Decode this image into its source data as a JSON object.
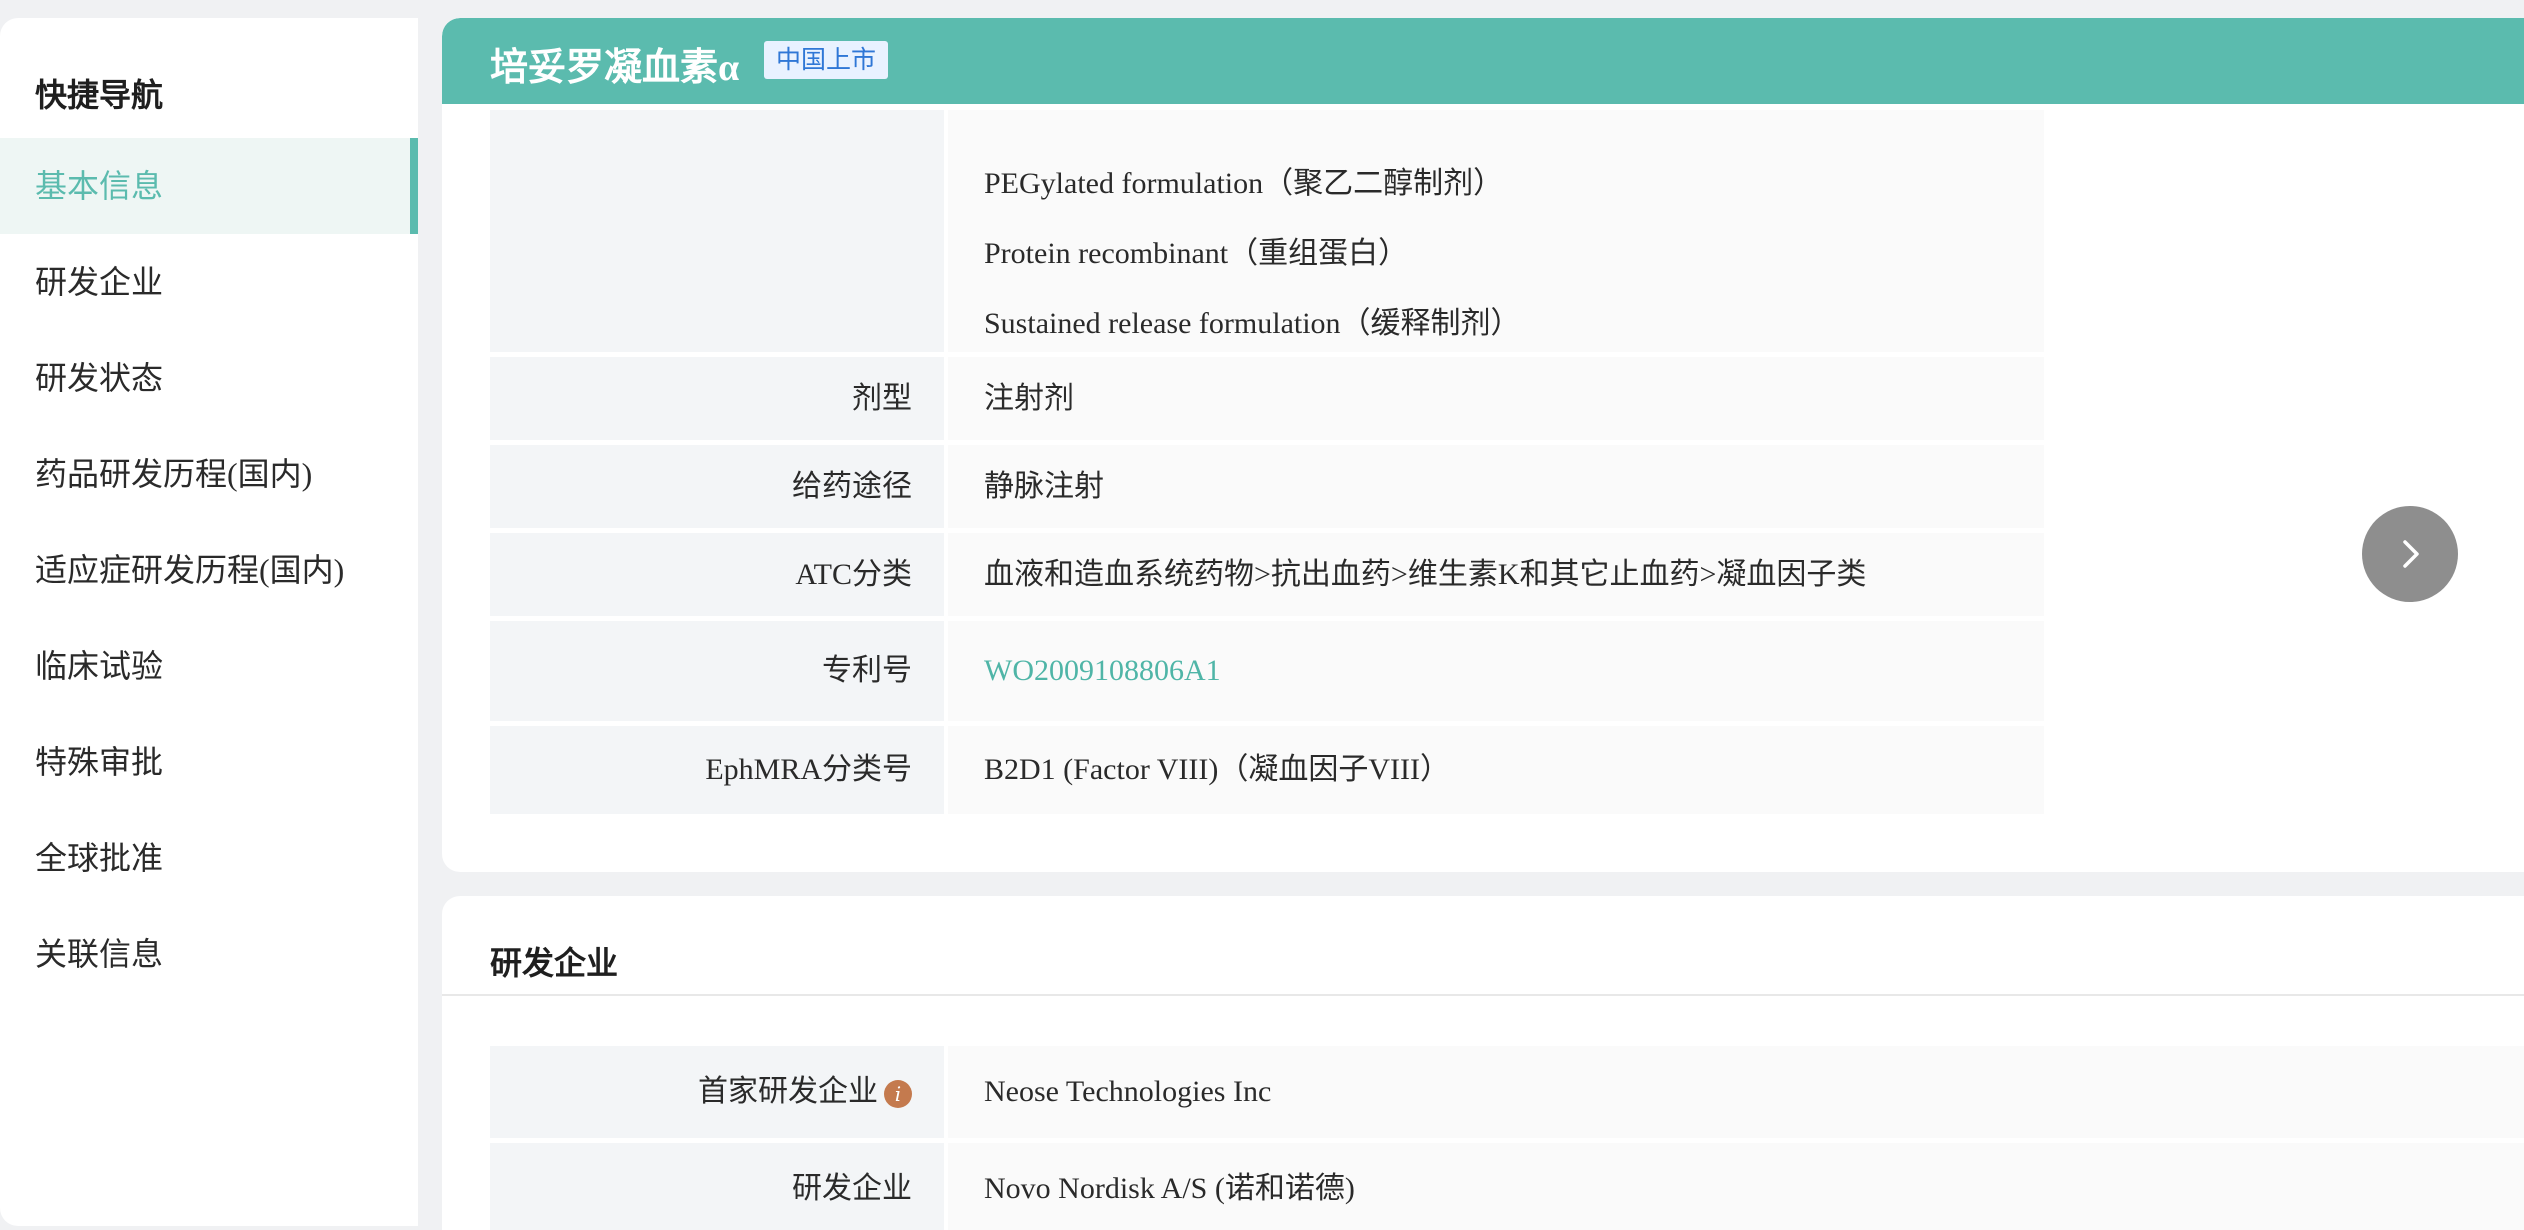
{
  "sidebar": {
    "title": "快捷导航",
    "items": [
      {
        "label": "基本信息",
        "active": true
      },
      {
        "label": "研发企业"
      },
      {
        "label": "研发状态"
      },
      {
        "label": "药品研发历程(国内)"
      },
      {
        "label": "适应症研发历程(国内)"
      },
      {
        "label": "临床试验"
      },
      {
        "label": "特殊审批"
      },
      {
        "label": "全球批准"
      },
      {
        "label": "关联信息"
      }
    ]
  },
  "header": {
    "title": "培妥罗凝血素α",
    "badge": "中国上市"
  },
  "basic_info": {
    "technology_lines": [
      "PEGylated formulation（聚乙二醇制剂）",
      "Protein recombinant（重组蛋白）",
      "Sustained release formulation（缓释制剂）"
    ],
    "rows": [
      {
        "label": "剂型",
        "value": "注射剂"
      },
      {
        "label": "给药途径",
        "value": "静脉注射"
      },
      {
        "label": "ATC分类",
        "value": "血液和造血系统药物>抗出血药>维生素K和其它止血药>凝血因子类"
      },
      {
        "label": "专利号",
        "value": "WO2009108806A1"
      },
      {
        "label": "EphMRA分类号",
        "value": "B2D1 (Factor VIII)（凝血因子VIII）"
      }
    ]
  },
  "company_section": {
    "title": "研发企业",
    "rows": [
      {
        "label": "首家研发企业",
        "value": "Neose Technologies Inc"
      },
      {
        "label": "研发企业",
        "value": "Novo Nordisk A/S (诺和诺德)"
      }
    ]
  },
  "icons": {
    "next": "chevron-right-icon",
    "info": "info-icon"
  },
  "colors": {
    "accent": "#5bbbae",
    "badge_text": "#2f77d6",
    "link": "#4fb5a7",
    "info_icon": "#c47a4e"
  }
}
